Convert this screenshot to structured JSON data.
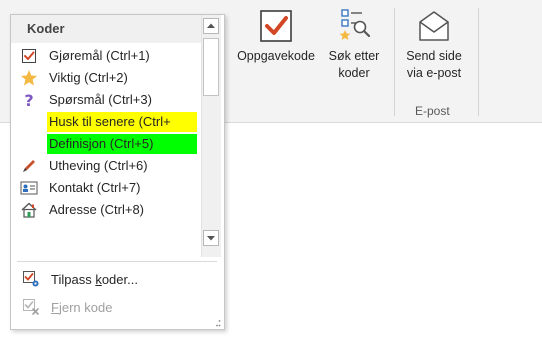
{
  "ribbon": {
    "tags_button_label": "Oppgavekode",
    "find_tags_line1": "Søk etter",
    "find_tags_line2": "koder",
    "email_line1": "Send side",
    "email_line2": "via e-post",
    "email_group_label": "E-post"
  },
  "tags_menu": {
    "header": "Koder",
    "items": [
      {
        "label": "Gjøremål (Ctrl+1)",
        "icon": "checkbox-check-icon"
      },
      {
        "label": "Viktig (Ctrl+2)",
        "icon": "star-icon"
      },
      {
        "label": "Spørsmål (Ctrl+3)",
        "icon": "question-icon"
      },
      {
        "label": "Husk til senere (Ctrl+",
        "icon": "none",
        "highlight": "#ffff00"
      },
      {
        "label": "Definisjon (Ctrl+5)",
        "icon": "none",
        "highlight": "#00ff00"
      },
      {
        "label": "Utheving (Ctrl+6)",
        "icon": "pen-icon"
      },
      {
        "label": "Kontakt (Ctrl+7)",
        "icon": "contact-card-icon"
      },
      {
        "label": "Adresse (Ctrl+8)",
        "icon": "house-icon"
      }
    ],
    "customize_label_pre": "Tilpass ",
    "customize_label_ul": "k",
    "customize_label_post": "oder...",
    "remove_label_ul": "F",
    "remove_label_post": "jern kode"
  },
  "colors": {
    "accent_red": "#d24726",
    "star_orange": "#f4b942",
    "question_purple": "#7e57c2",
    "highlight_yellow": "#ffff00",
    "highlight_green": "#00ff00"
  }
}
